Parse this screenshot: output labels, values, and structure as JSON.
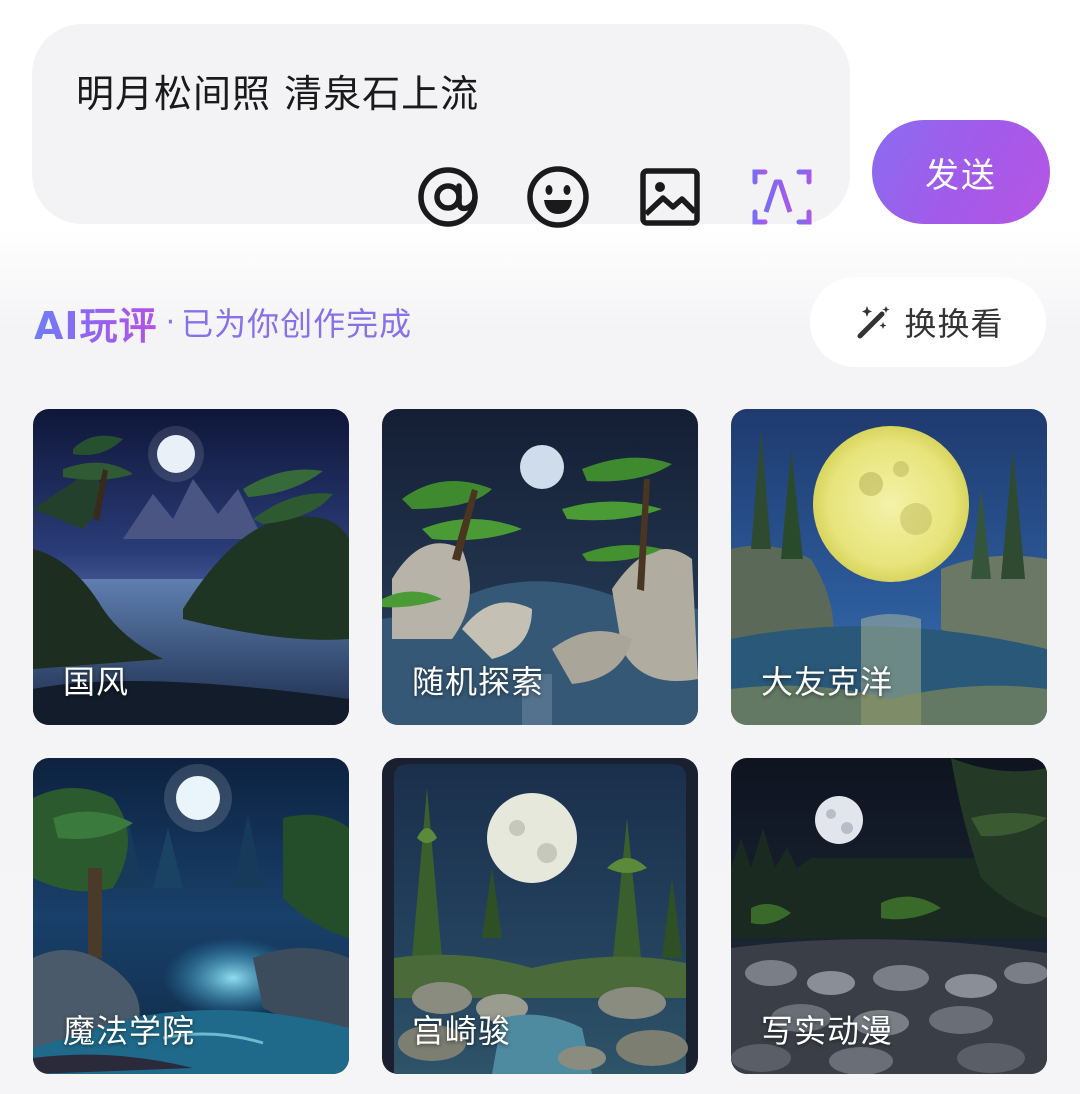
{
  "composer": {
    "text": "明月松间照 清泉石上流",
    "tools": [
      "at-icon",
      "emoji-icon",
      "image-icon",
      "ai-icon"
    ],
    "send_label": "发送"
  },
  "section": {
    "brand": "AI玩评",
    "separator": "·",
    "status": "已为你创作完成",
    "refresh_label": "换换看"
  },
  "colors": {
    "accent": "#9b5ef0",
    "send_gradient_start": "#8a6cf2",
    "send_gradient_end": "#b655e4"
  },
  "styles": [
    {
      "label": "国风"
    },
    {
      "label": "随机探索"
    },
    {
      "label": "大友克洋"
    },
    {
      "label": "魔法学院"
    },
    {
      "label": "宫崎骏"
    },
    {
      "label": "写实动漫"
    }
  ]
}
